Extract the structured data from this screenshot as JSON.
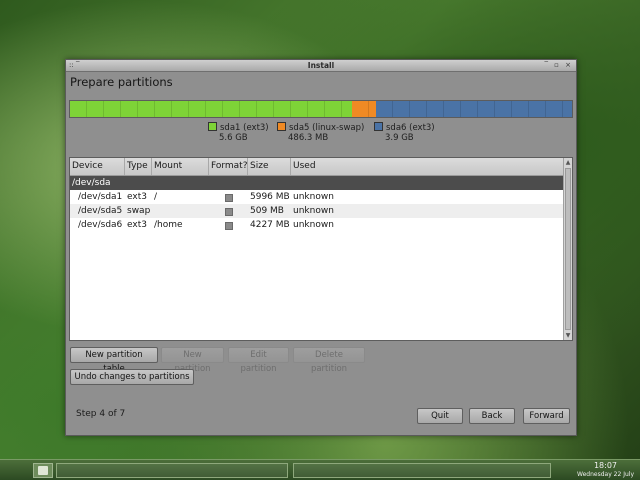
{
  "window": {
    "title": "Install",
    "left_controls": "::  ‾",
    "right_controls": "‾ ▫ ×"
  },
  "page": {
    "heading": "Prepare partitions",
    "step": "Step 4 of 7"
  },
  "partition_bar": {
    "segments": [
      {
        "name": "sda1 (ext3)",
        "size": "5.6 GB",
        "color": "#7ed337",
        "fraction": 0.562
      },
      {
        "name": "sda5 (linux-swap)",
        "size": "486.3 MB",
        "color": "#f08a24",
        "fraction": 0.047
      },
      {
        "name": "sda6 (ext3)",
        "size": "3.9 GB",
        "color": "#4a73a6",
        "fraction": 0.391
      }
    ]
  },
  "table": {
    "headers": [
      "Device",
      "Type",
      "Mount point",
      "Format?",
      "Size",
      "Used"
    ],
    "disk": "/dev/sda",
    "rows": [
      {
        "device": "/dev/sda1",
        "type": "ext3",
        "mount": "/",
        "size": "5996 MB",
        "used": "unknown"
      },
      {
        "device": "/dev/sda5",
        "type": "swap",
        "mount": "",
        "size": "509 MB",
        "used": "unknown"
      },
      {
        "device": "/dev/sda6",
        "type": "ext3",
        "mount": "/home",
        "size": "4227 MB",
        "used": "unknown"
      }
    ]
  },
  "buttons": {
    "new_table": "New partition table",
    "new_partition": "New partition",
    "edit_partition": "Edit partition",
    "delete_partition": "Delete partition",
    "undo": "Undo changes to partitions",
    "quit": "Quit",
    "back": "Back",
    "forward": "Forward"
  },
  "taskbar": {
    "time": "18:07",
    "date": "Wednesday 22 July"
  }
}
